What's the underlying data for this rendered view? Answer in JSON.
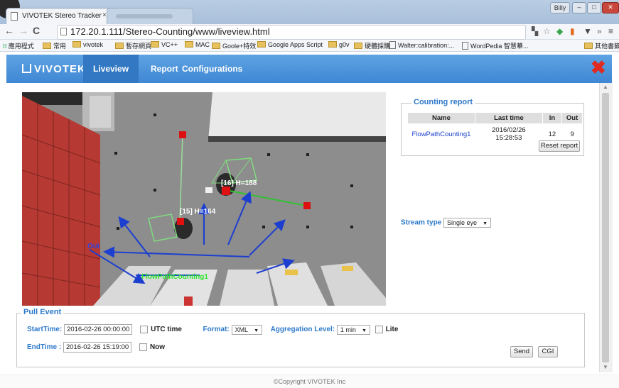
{
  "browser": {
    "tab_title": "VIVOTEK Stereo Tracker",
    "tab_close": "×",
    "user_badge": "Billy",
    "url": "172.20.1.111/Stereo-Counting/www/liveview.html",
    "back_glyph": "←",
    "forward_glyph": "→",
    "reload_glyph": "C",
    "menu_glyph": "≡",
    "bookmarks": [
      "應用程式",
      "常用",
      "vivotek",
      "暫存網頁",
      "VC++",
      "MAC",
      "Goole+特效",
      "Google Apps Script",
      "g0v",
      "硬體採購",
      "Walter:calibration:...",
      "WordPedia 智慧華..."
    ],
    "other_bookmarks": "其他書籤"
  },
  "app": {
    "logo": "VIVOTEK",
    "nav": [
      "Liveview",
      "Report",
      "Configurations"
    ],
    "active_nav": "Liveview",
    "close_glyph": "✖",
    "colors": {
      "header": "#4a92d8",
      "active_tab": "#3278c2",
      "accent": "#2d79c9",
      "close": "#e02a20"
    }
  },
  "video": {
    "overlay_labels": {
      "track16": "[16]  H=188",
      "track15": "[15]  H=164",
      "out": "Out",
      "flow": "FlowPathCounting1"
    }
  },
  "report": {
    "title": "Counting report",
    "headers": [
      "Name",
      "Last time",
      "In",
      "Out"
    ],
    "rows": [
      {
        "name": "FlowPathCounting1",
        "last_time": "2016/02/26 15:28:53",
        "in": "12",
        "out": "9"
      }
    ],
    "reset_button": "Reset report"
  },
  "stream": {
    "label": "Stream type",
    "selected": "Single eye"
  },
  "pull_event": {
    "title": "Pull Event",
    "start_label": "StartTime:",
    "start_value": "2016-02-26 00:00:00",
    "utc_label": "UTC time",
    "format_label": "Format:",
    "format_value": "XML",
    "aggregation_label": "Aggregation Level:",
    "aggregation_value": "1 min",
    "lite_label": "Lite",
    "end_label": "EndTime :",
    "end_value": "2016-02-26 15:19:00",
    "now_label": "Now",
    "send_button": "Send",
    "cgi_button": "CGI"
  },
  "footer": {
    "copyright": "©Copyright VIVOTEK Inc"
  }
}
